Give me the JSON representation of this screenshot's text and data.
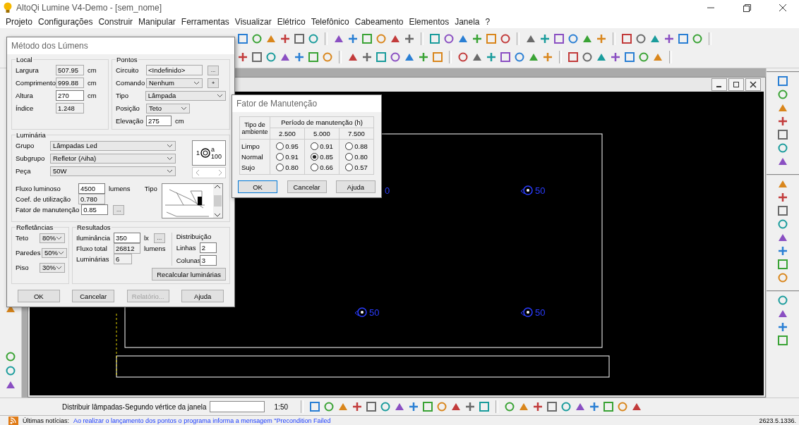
{
  "window": {
    "title": "AltoQi Lumine V4-Demo - [sem_nome]"
  },
  "menu": [
    "Projeto",
    "Configurações",
    "Construir",
    "Manipular",
    "Ferramentas",
    "Visualizar",
    "Elétrico",
    "Telefônico",
    "Cabeamento",
    "Elementos",
    "Janela",
    "?"
  ],
  "drawing": {
    "labels": [
      "0",
      "50",
      "50",
      "50"
    ]
  },
  "lumens_dialog": {
    "title": "Método dos Lúmens",
    "local": {
      "legend": "Local",
      "fields": [
        {
          "label": "Largura",
          "value": "507.95",
          "unit": "cm",
          "disabled": true
        },
        {
          "label": "Comprimento",
          "value": "999.88",
          "unit": "cm",
          "disabled": true
        },
        {
          "label": "Altura",
          "value": "270",
          "unit": "cm",
          "disabled": false
        },
        {
          "label": "Índice",
          "value": "1.248",
          "disabled": true
        }
      ]
    },
    "pontos": {
      "legend": "Pontos",
      "circuit_label": "Circuito",
      "circuit_value": "<Indefinido>",
      "circuit_button": "...",
      "command_label": "Comando",
      "command_value": "Nenhum",
      "command_button": "+",
      "type_label": "Tipo",
      "type_value": "Lâmpada",
      "position_label": "Posição",
      "position_value": "Teto",
      "elevation_label": "Elevação",
      "elevation_value": "275",
      "elevation_unit": "cm"
    },
    "luminaria": {
      "legend": "Luminária",
      "selects": [
        {
          "label": "Grupo",
          "value": "Lâmpadas Led"
        },
        {
          "label": "Subgrupo",
          "value": "Refletor (Aiha)"
        },
        {
          "label": "Peça",
          "value": "50W"
        }
      ],
      "symbol": {
        "circuit": "1",
        "letter": "a",
        "power": "100"
      },
      "flux_label": "Fluxo luminoso",
      "flux_value": "4500",
      "flux_unit": "lumens",
      "type_label": "Tipo",
      "coef_label": "Coef. de utilização",
      "coef_value": "0.780",
      "factor_label": "Fator de manutenção",
      "factor_value": "0.85",
      "factor_button": "..."
    },
    "reflectances": {
      "legend": "Refletâncias",
      "items": [
        {
          "label": "Teto",
          "value": "80%"
        },
        {
          "label": "Paredes",
          "value": "50%"
        },
        {
          "label": "Piso",
          "value": "30%"
        }
      ]
    },
    "results": {
      "legend": "Resultados",
      "illum_label": "Iluminância",
      "illum_value": "350",
      "illum_unit": "lx",
      "illum_button": "...",
      "total_label": "Fluxo total",
      "total_value": "26812",
      "total_unit": "lumens",
      "count_label": "Luminárias",
      "count_value": "6"
    },
    "distribution": {
      "legend": "Distribuição",
      "rows_label": "Linhas",
      "rows_value": "2",
      "cols_label": "Colunas",
      "cols_value": "3",
      "recalc_button": "Recalcular luminárias"
    },
    "buttons": [
      {
        "label": "OK",
        "disabled": false
      },
      {
        "label": "Cancelar",
        "disabled": false
      },
      {
        "label": "Relatório...",
        "disabled": true
      },
      {
        "label": "Ajuda",
        "disabled": false
      }
    ]
  },
  "maintenance": {
    "title": "Fator de Manutenção",
    "env_header": "Tipo de ambiente",
    "period_header": "Período de manutenção (h)",
    "periods": [
      "2.500",
      "5.000",
      "7.500"
    ],
    "rows": [
      {
        "label": "Limpo",
        "options": [
          {
            "value": "0.95",
            "selected": false
          },
          {
            "value": "0.91",
            "selected": false
          },
          {
            "value": "0.88",
            "selected": false
          }
        ]
      },
      {
        "label": "Normal",
        "options": [
          {
            "value": "0.91",
            "selected": false
          },
          {
            "value": "0.85",
            "selected": true
          },
          {
            "value": "0.80",
            "selected": false
          }
        ]
      },
      {
        "label": "Sujo",
        "options": [
          {
            "value": "0.80",
            "selected": false
          },
          {
            "value": "0.66",
            "selected": false
          },
          {
            "value": "0.57",
            "selected": false
          }
        ]
      }
    ],
    "buttons": [
      "OK",
      "Cancelar",
      "Ajuda"
    ]
  },
  "command_bar": {
    "prompt": "Distribuir lâmpadas-Segundo vértice da janela",
    "scale": "1:50"
  },
  "status_bar": {
    "news_label": "Últimas notícias:",
    "news_link": "Ao realizar o lançamento dos pontos o programa informa a mensagem \"Precondition Failed",
    "version": "2623.5.1336."
  }
}
